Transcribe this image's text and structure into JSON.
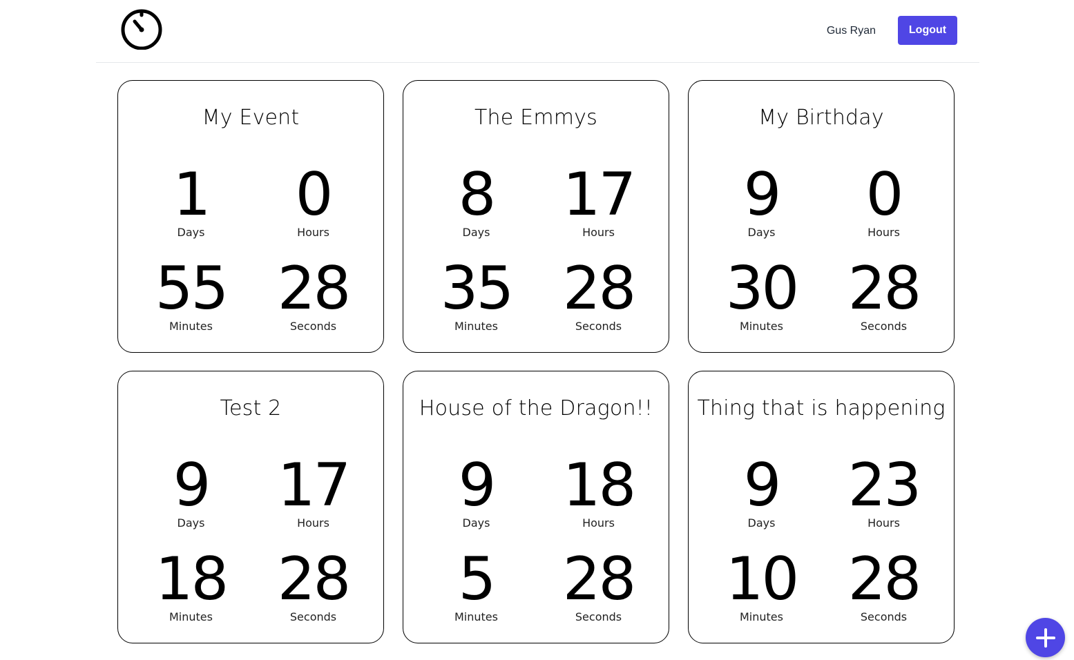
{
  "header": {
    "user_name": "Gus Ryan",
    "logout_label": "Logout",
    "logo_icon": "timer-icon"
  },
  "accent_color": "#4f46e5",
  "cards": [
    {
      "title": "My Event",
      "days": "1",
      "hours": "0",
      "minutes": "55",
      "seconds": "28"
    },
    {
      "title": "The Emmys",
      "days": "8",
      "hours": "17",
      "minutes": "35",
      "seconds": "28"
    },
    {
      "title": "My Birthday",
      "days": "9",
      "hours": "0",
      "minutes": "30",
      "seconds": "28"
    },
    {
      "title": "Test 2",
      "days": "9",
      "hours": "17",
      "minutes": "18",
      "seconds": "28"
    },
    {
      "title": "House of the Dragon!!",
      "days": "9",
      "hours": "18",
      "minutes": "5",
      "seconds": "28"
    },
    {
      "title": "Thing that is happening",
      "days": "9",
      "hours": "23",
      "minutes": "10",
      "seconds": "28"
    }
  ],
  "labels": {
    "days": "Days",
    "hours": "Hours",
    "minutes": "Minutes",
    "seconds": "Seconds"
  },
  "fab": {
    "icon": "plus-icon"
  }
}
